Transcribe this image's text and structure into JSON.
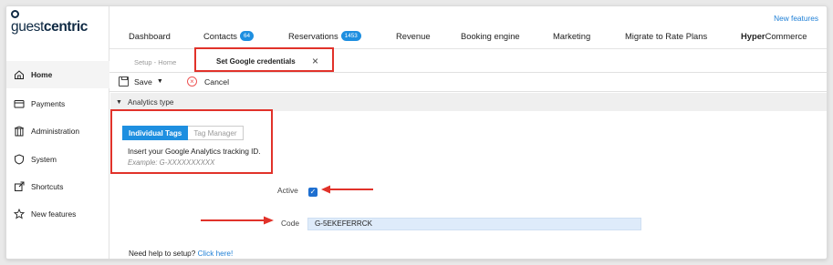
{
  "app": {
    "logo_text_regular": "guest",
    "logo_text_bold": "centric",
    "new_features_link": "New features"
  },
  "sidebar": {
    "items": [
      {
        "label": "Home",
        "icon": "home-icon",
        "active": true
      },
      {
        "label": "Payments",
        "icon": "credit-card-icon"
      },
      {
        "label": "Administration",
        "icon": "building-icon"
      },
      {
        "label": "System",
        "icon": "shield-icon"
      },
      {
        "label": "Shortcuts",
        "icon": "external-link-icon"
      },
      {
        "label": "New features",
        "icon": "star-icon"
      }
    ]
  },
  "topnav": {
    "items": [
      {
        "label": "Dashboard"
      },
      {
        "label": "Contacts",
        "badge": "64"
      },
      {
        "label": "Reservations",
        "badge": "1453"
      },
      {
        "label": "Revenue"
      },
      {
        "label": "Booking engine"
      },
      {
        "label": "Marketing"
      },
      {
        "label": "Migrate to Rate Plans"
      },
      {
        "label_bold": "Hyper",
        "label_rest": "Commerce"
      }
    ]
  },
  "tabs": {
    "breadcrumb": "Setup - Home",
    "active": "Set Google credentials",
    "close_glyph": "×"
  },
  "toolbar": {
    "save_label": "Save",
    "cancel_label": "Cancel"
  },
  "section": {
    "title": "Analytics type"
  },
  "tag_tabs": {
    "individual": "Individual Tags",
    "manager": "Tag Manager"
  },
  "form": {
    "help_text": "Insert your Google Analytics tracking ID.",
    "example": "Example: G-XXXXXXXXXX",
    "active_label": "Active",
    "active_checked": true,
    "code_label": "Code",
    "code_value": "G-5EKEFERRCK",
    "need_help_text": "Need help to setup?",
    "need_help_link": "Click here!"
  },
  "colors": {
    "accent": "#1e8fe0",
    "annotation_red": "#e1322a",
    "brand": "#0f2a44"
  }
}
